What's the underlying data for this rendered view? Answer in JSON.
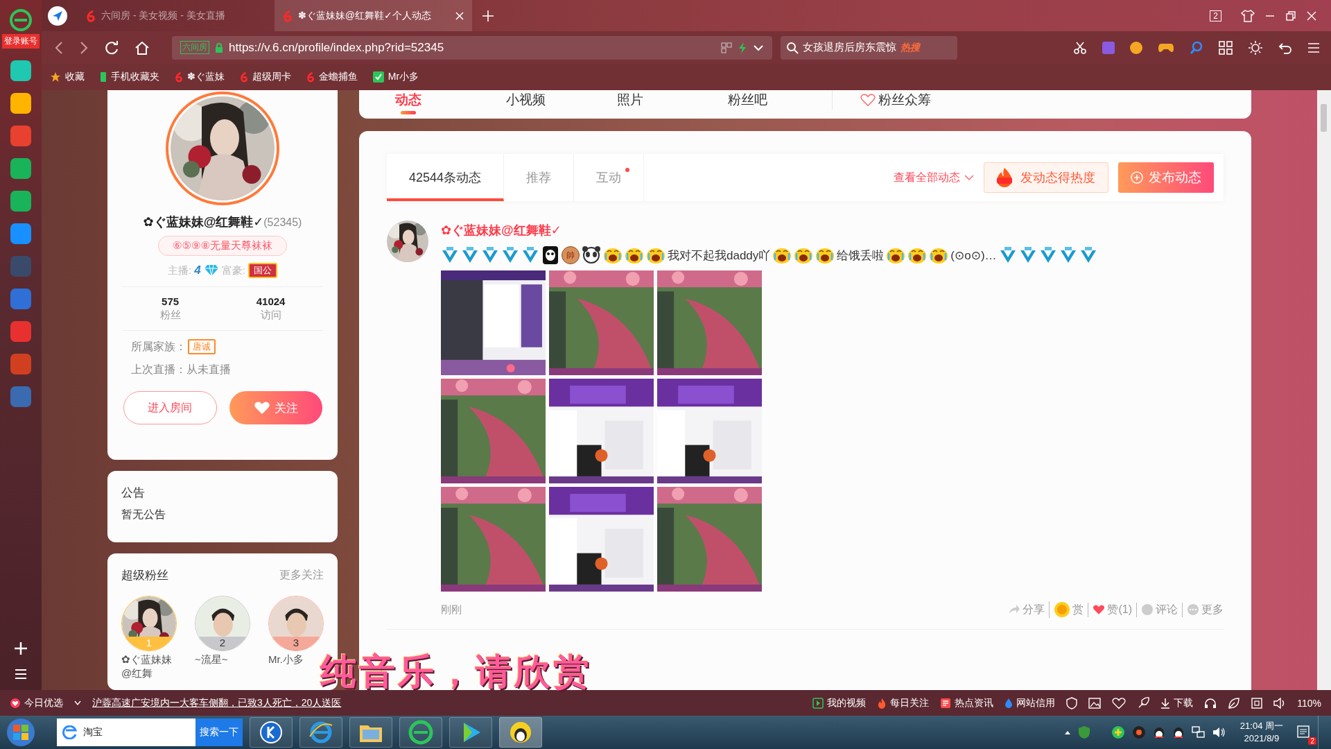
{
  "browser": {
    "login_label": "登录账号",
    "tabs": [
      {
        "title": "六间房 - 美女视频 - 美女直播",
        "selected": false
      },
      {
        "title": "✽ぐ蓝妹妹@红舞鞋✓个人动态",
        "selected": true
      }
    ],
    "tab_count": "2",
    "address": {
      "site_badge": "六间房",
      "url": "https://v.6.cn/profile/index.php?rid=52345"
    },
    "search": {
      "value": "女孩退房后房东震惊",
      "hot_label": "热搜"
    },
    "bookmarks": [
      {
        "label": "收藏",
        "kind": "star"
      },
      {
        "label": "手机收藏夹",
        "kind": "phone"
      },
      {
        "label": "✽ぐ蓝妹",
        "kind": "six"
      },
      {
        "label": "超级周卡",
        "kind": "six"
      },
      {
        "label": "金蟾捕鱼",
        "kind": "six"
      },
      {
        "label": "Mr小多",
        "kind": "green"
      }
    ]
  },
  "profile": {
    "name": "✿ぐ蓝妹妹@红舞鞋✓",
    "rid": "(52345)",
    "badge": "⑥⑤⑨⑧无量天尊袜袜",
    "anchor_label": "主播:",
    "anchor_level": "4",
    "rich_label": "富豪:",
    "rich_title": "国公",
    "stats": [
      {
        "value": "575",
        "label": "粉丝"
      },
      {
        "value": "41024",
        "label": "访问"
      }
    ],
    "family_label": "所属家族：",
    "family": "唐诚",
    "last_live": "上次直播：从未直播",
    "enter_button": "进入房间",
    "follow_button": "关注"
  },
  "notice": {
    "title": "公告",
    "text": "暂无公告"
  },
  "super_fans": {
    "title": "超级粉丝",
    "more": "更多关注",
    "fans": [
      {
        "rank": "1",
        "name": "✿ぐ蓝妹妹@红舞"
      },
      {
        "rank": "2",
        "name": "~流星~"
      },
      {
        "rank": "3",
        "name": "Mr.小多"
      }
    ]
  },
  "nav": {
    "tabs": [
      {
        "label": "动态",
        "selected": true,
        "kind": "plain"
      },
      {
        "label": "小视频",
        "selected": false,
        "kind": "plain"
      },
      {
        "label": "照片",
        "selected": false,
        "kind": "plain"
      },
      {
        "label": "粉丝吧",
        "selected": false,
        "kind": "plain"
      },
      {
        "label": "粉丝众筹",
        "selected": false,
        "kind": "crowdfund"
      }
    ]
  },
  "feed": {
    "tabs": [
      {
        "label": "42544条动态",
        "selected": true,
        "unread": false
      },
      {
        "label": "推荐",
        "selected": false,
        "unread": false
      },
      {
        "label": "互动",
        "selected": false,
        "unread": true
      }
    ],
    "filter": "查看全部动态",
    "hot_button": "发动态得热度",
    "publish_button": "发布动态",
    "posts": [
      {
        "author": "✿ぐ蓝妹妹@红舞鞋✓",
        "content": [
          {
            "kind": "five"
          },
          {
            "kind": "five"
          },
          {
            "kind": "five"
          },
          {
            "kind": "five"
          },
          {
            "kind": "five"
          },
          {
            "kind": "ghost"
          },
          {
            "kind": "badge",
            "text": "帥"
          },
          {
            "kind": "panda"
          },
          {
            "kind": "cry"
          },
          {
            "kind": "cry"
          },
          {
            "kind": "cry"
          },
          {
            "kind": "text",
            "text": "我对不起我daddy吖"
          },
          {
            "kind": "cry"
          },
          {
            "kind": "cry"
          },
          {
            "kind": "cry"
          },
          {
            "kind": "text",
            "text": "给饿丢啦"
          },
          {
            "kind": "cry"
          },
          {
            "kind": "cry"
          },
          {
            "kind": "cry"
          },
          {
            "kind": "text",
            "text": "(⊙o⊙)…"
          },
          {
            "kind": "five"
          },
          {
            "kind": "five"
          },
          {
            "kind": "five"
          },
          {
            "kind": "five"
          },
          {
            "kind": "five"
          }
        ],
        "images": [
          {
            "kind": "picture"
          },
          {
            "kind": "picture"
          },
          {
            "kind": "picture"
          },
          {
            "kind": "picture"
          },
          {
            "kind": "picture"
          },
          {
            "kind": "picture"
          },
          {
            "kind": "picture"
          },
          {
            "kind": "picture"
          },
          {
            "kind": "picture"
          }
        ],
        "time": "刚刚",
        "actions": [
          {
            "label": "分享",
            "kind": "share"
          },
          {
            "label": "赏",
            "kind": "reward"
          },
          {
            "label": "赞(1)",
            "kind": "like"
          },
          {
            "label": "评论",
            "kind": "comment"
          },
          {
            "label": "更多",
            "kind": "more"
          }
        ]
      }
    ]
  },
  "lyrics": "纯音乐，请欣赏",
  "status_bar": {
    "news_label": "今日优选",
    "headline": "沪蓉高速广安境内一大客车侧翻，已致3人死亡，20人送医",
    "links": [
      {
        "label": "我的视频",
        "kind": "video"
      },
      {
        "label": "每日关注",
        "kind": "fire"
      },
      {
        "label": "热点资讯",
        "kind": "news"
      },
      {
        "label": "网站信用",
        "kind": "drop"
      }
    ],
    "download": "下载",
    "zoom": "110%"
  },
  "taskbar": {
    "search_value": "淘宝",
    "search_button": "搜索一下",
    "time": "21:04 周一",
    "date": "2021/8/9",
    "notification_count": "2"
  }
}
